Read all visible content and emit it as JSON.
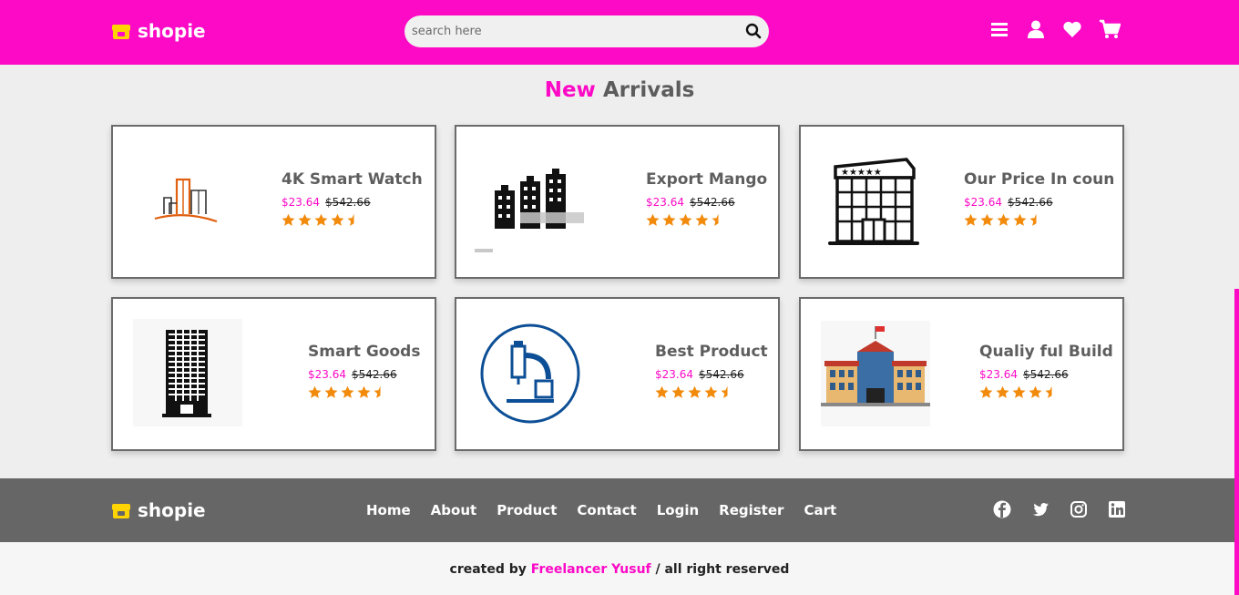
{
  "brand": {
    "name": "shopie",
    "color": "#fc0ac6"
  },
  "header": {
    "search_placeholder": "search here",
    "icons": [
      "menu-icon",
      "user-icon",
      "heart-icon",
      "cart-icon"
    ]
  },
  "section": {
    "title_highlight": "New",
    "title_rest": "Arrivals"
  },
  "products": [
    {
      "name": "4K Smart Watch",
      "price": "$23.64",
      "old_price": "$542.66",
      "rating": 4.5,
      "icon": "city-buildings-icon"
    },
    {
      "name": "Export Mango",
      "price": "$23.64",
      "old_price": "$542.66",
      "rating": 4.5,
      "icon": "towers-icon"
    },
    {
      "name": "Our Price In coun",
      "price": "$23.64",
      "old_price": "$542.66",
      "rating": 4.5,
      "icon": "hotel-building-icon"
    },
    {
      "name": "Smart Goods",
      "price": "$23.64",
      "old_price": "$542.66",
      "rating": 4.5,
      "icon": "skyscraper-icon"
    },
    {
      "name": "Best Product",
      "price": "$23.64",
      "old_price": "$542.66",
      "rating": 4.5,
      "icon": "microscope-icon"
    },
    {
      "name": "Qualiy ful Build",
      "price": "$23.64",
      "old_price": "$542.66",
      "rating": 4.5,
      "icon": "school-building-icon"
    }
  ],
  "footer": {
    "nav": [
      "Home",
      "About",
      "Product",
      "Contact",
      "Login",
      "Register",
      "Cart"
    ],
    "social": [
      "facebook-icon",
      "twitter-icon",
      "instagram-icon",
      "linkedin-icon"
    ]
  },
  "credit": {
    "prefix": "created by",
    "author": "Freelancer Yusuf",
    "suffix": "/ all right reserved"
  },
  "colors": {
    "accent": "#fc0ac6",
    "star": "#f28a0c",
    "footer_bg": "#666666"
  }
}
